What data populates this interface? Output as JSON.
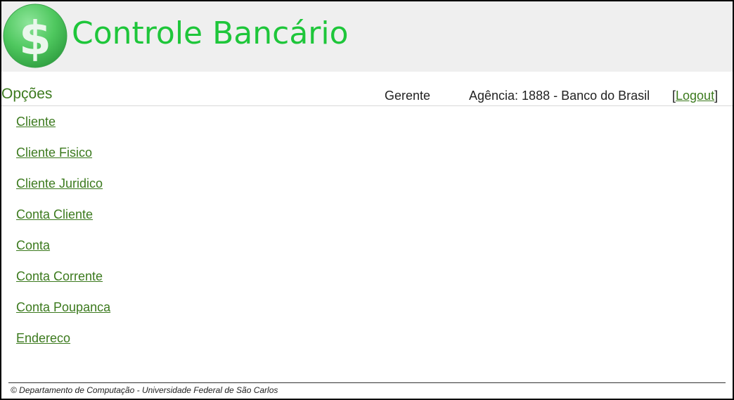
{
  "header": {
    "logo_symbol": "$",
    "title": "Controle Bancário"
  },
  "topbar": {
    "options_title": "Opções",
    "role": "Gerente",
    "agency": "Agência: 1888 - Banco do Brasil",
    "logout_open": "[",
    "logout_label": "Logout",
    "logout_close": "]"
  },
  "menu": {
    "items": [
      {
        "label": "Cliente"
      },
      {
        "label": "Cliente Fisico"
      },
      {
        "label": "Cliente Juridico"
      },
      {
        "label": "Conta Cliente"
      },
      {
        "label": "Conta"
      },
      {
        "label": "Conta Corrente"
      },
      {
        "label": "Conta Poupanca"
      },
      {
        "label": "Endereco"
      }
    ]
  },
  "footer": {
    "text": "© Departamento de Computação - Universidade Federal de São Carlos"
  },
  "colors": {
    "title_green": "#1ec63a",
    "link_green": "#3c7a1e",
    "header_bg": "#efefef"
  },
  "icons": {
    "logo": "dollar-coin-icon"
  }
}
